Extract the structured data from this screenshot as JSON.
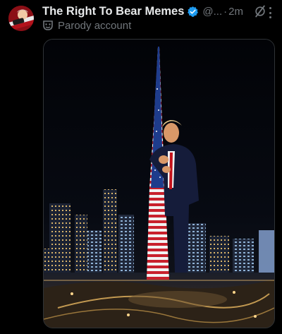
{
  "post": {
    "author_name": "The Right To Bear Memes",
    "handle": "@...",
    "separator": "·",
    "time": "2m",
    "account_label": "Parody account"
  },
  "icons": {
    "verified": "verified-badge-icon",
    "grok": "grok-icon",
    "more": "more-options-icon",
    "parody": "parody-mask-icon"
  },
  "colors": {
    "verified_blue": "#1d9bf0",
    "muted_text": "#71767b",
    "primary_text": "#e7e9ea"
  }
}
